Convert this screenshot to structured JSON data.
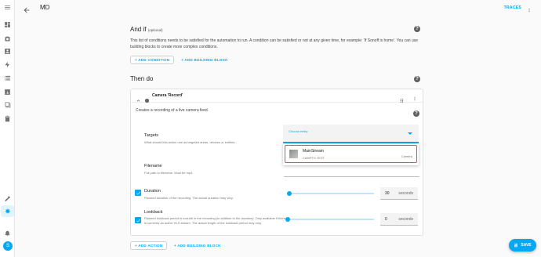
{
  "header": {
    "title": "MD",
    "traces": "TRACES"
  },
  "and_if": {
    "title": "And if",
    "optional": "(optional)",
    "description": "This list of conditions needs to be satisfied for the automation to run. A condition can be satisfied or not at any given time, for example: 'If Sonoff is home'. You can use building blocks to create more complex conditions.",
    "add_condition": "+ ADD CONDITION",
    "add_building_block": "+ ADD BUILDING BLOCK"
  },
  "then_do": {
    "title": "Then do",
    "action": {
      "title": "Camera 'Record'",
      "description": "Creates a recording of a live camera feed.",
      "targets": {
        "label": "Targets",
        "sub": "What should this action use as targeted areas, devices or entities."
      },
      "choose_entity": "Choose entity",
      "option": {
        "name": "MainStream",
        "sub": "CAMPTS TEST",
        "tag": "Camera"
      },
      "filename": {
        "label": "Filename",
        "sub": "Full path to filename. Must be mp4."
      },
      "duration": {
        "label": "Duration",
        "sub": "Planned duration of the recording. The actual duration may vary.",
        "value": "30",
        "unit": "seconds",
        "fraction": 0.02
      },
      "lookback": {
        "label": "Lookback",
        "sub": "Planned lookback period to include in the recording (in addition to the duration). Only available if there is currently an active HLS stream. The actual length of the lookback period may vary.",
        "value": "0",
        "unit": "seconds",
        "fraction": 0.0
      }
    },
    "add_action": "+ ADD ACTION",
    "add_building_block": "+ ADD BUILDING BLOCK"
  },
  "save": "SAVE",
  "avatar_letter": "S",
  "colors": {
    "accent": "#03a9f4",
    "highlight": "#d9534f"
  }
}
